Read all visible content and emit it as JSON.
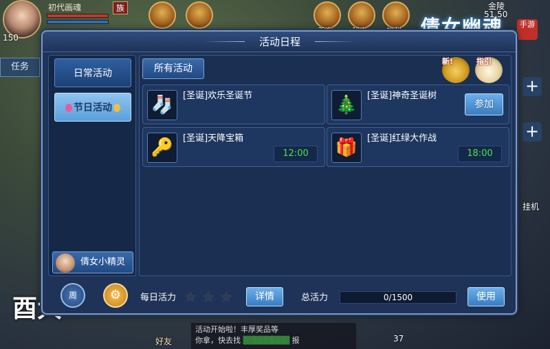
{
  "hud": {
    "player_name": "初代画魂",
    "faction_badge": "族",
    "level": "150",
    "task_label": "任务",
    "top_icons": [
      "首充",
      "超市",
      "福利"
    ],
    "location": "金陵",
    "coords": "51,50",
    "afk_label": "挂机",
    "friend_label": "好友",
    "chat_line1": "活动开始啦！丰厚奖品等",
    "chat_line2": "你拿，快去找",
    "chat_tail": "报",
    "bottom_num": "37",
    "logo_text": "倩女幽魂",
    "logo_badge": "手游",
    "corner_logo": "酉大"
  },
  "dialog": {
    "title": "活动日程",
    "tabs": [
      {
        "label": "日常活动"
      },
      {
        "label": "节日活动"
      }
    ],
    "filter_label": "所有活动",
    "corner_icons": [
      {
        "icon": "new-horn-icon",
        "label": "新!"
      },
      {
        "icon": "guide-book-icon",
        "label": "指引"
      }
    ],
    "activities": [
      {
        "name": "[圣诞]欢乐圣诞节",
        "icon": "christmas-stocking-icon",
        "glyph": "🧦",
        "time": "",
        "action": ""
      },
      {
        "name": "[圣诞]神奇圣诞树",
        "icon": "christmas-tree-icon",
        "glyph": "🎄",
        "time": "",
        "action": "参加"
      },
      {
        "name": "[圣诞]天降宝箱",
        "icon": "golden-key-icon",
        "glyph": "🔑",
        "time": "12:00",
        "action": ""
      },
      {
        "name": "[圣诞]红绿大作战",
        "icon": "gift-box-icon",
        "glyph": "🎁",
        "time": "18:00",
        "action": ""
      }
    ],
    "sprite_label": "倩女小精灵",
    "footer": {
      "week_label": "周",
      "daily_vitality_label": "每日活力",
      "stars": 3,
      "detail_label": "详情",
      "total_vitality_label": "总活力",
      "vitality_value": "0/1500",
      "use_label": "使用"
    }
  }
}
